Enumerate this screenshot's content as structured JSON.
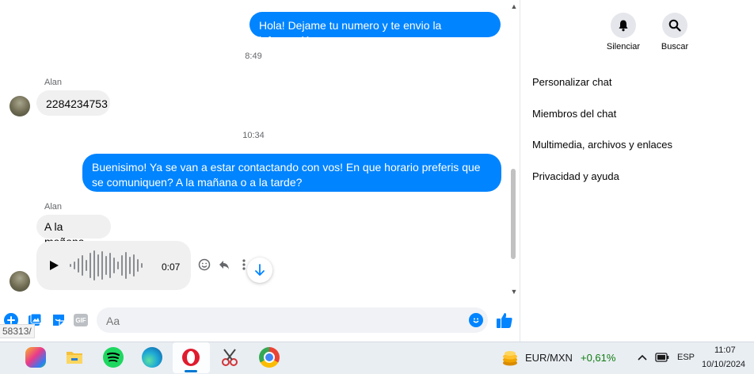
{
  "messages": {
    "out_1": "Hola! Dejame tu numero y te envio la información",
    "time_1": "8:49",
    "sender_1": "Alan",
    "in_1": "2284234753",
    "time_2": "10:34",
    "out_2": "Buenisimo! Ya se van a estar contactando con vos! En que horario preferis que se comuniquen? A la mañana o a la tarde?",
    "sender_2": "Alan",
    "in_2": "A la mañana",
    "voice_duration": "0:07"
  },
  "sidebar": {
    "mute_label": "Silenciar",
    "search_label": "Buscar",
    "items": [
      "Personalizar chat",
      "Miembros del chat",
      "Multimedia, archivos y enlaces",
      "Privacidad y ayuda"
    ]
  },
  "composer": {
    "placeholder": "Aa",
    "gif_label": "GIF",
    "url_fragment": "58313/"
  },
  "taskbar": {
    "currency_pair": "EUR/MXN",
    "currency_change": "+0,61%",
    "language": "ESP",
    "time": "11:07",
    "date": "10/10/2024"
  },
  "colors": {
    "accent": "#0084ff",
    "positive": "#107c10"
  }
}
